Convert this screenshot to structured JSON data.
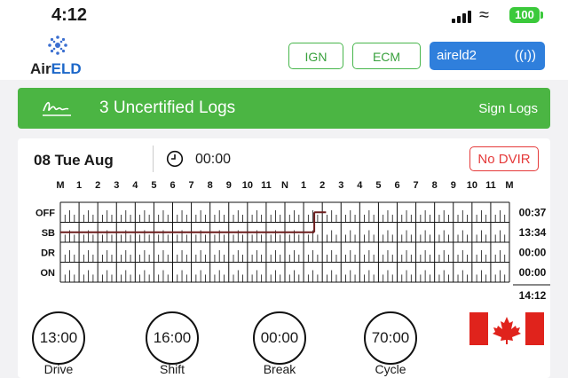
{
  "status_bar": {
    "time": "4:12",
    "battery": "100"
  },
  "header": {
    "logo": {
      "air": "Air",
      "eld": "ELD"
    },
    "ign_label": "IGN",
    "ecm_label": "ECM",
    "device_label": "aireld2",
    "device_icon": "((ı))"
  },
  "banner": {
    "title": "3 Uncertified Logs",
    "button": "Sign Logs"
  },
  "log": {
    "date": "08 Tue Aug",
    "clock": "00:00",
    "dvir": "No DVIR",
    "hour_labels": [
      "M",
      "1",
      "2",
      "3",
      "4",
      "5",
      "6",
      "7",
      "8",
      "9",
      "10",
      "11",
      "N",
      "1",
      "2",
      "3",
      "4",
      "5",
      "6",
      "7",
      "8",
      "9",
      "10",
      "11",
      "M"
    ],
    "rows": [
      {
        "label": "OFF",
        "total": "00:37"
      },
      {
        "label": "SB",
        "total": "13:34"
      },
      {
        "label": "DR",
        "total": "00:00"
      },
      {
        "label": "ON",
        "total": "00:00"
      }
    ],
    "grand_total": "14:12",
    "status_line": [
      {
        "status": "SB",
        "start": 0,
        "end": 13.57
      },
      {
        "status": "OFF",
        "start": 13.57,
        "end": 14.2
      }
    ],
    "line_color": "#6b1c1c"
  },
  "timers": [
    {
      "value": "13:00",
      "label": "Drive"
    },
    {
      "value": "16:00",
      "label": "Shift"
    },
    {
      "value": "00:00",
      "label": "Break"
    },
    {
      "value": "70:00",
      "label": "Cycle"
    }
  ],
  "flag": {
    "country": "Canada",
    "red": "#e0231c"
  }
}
